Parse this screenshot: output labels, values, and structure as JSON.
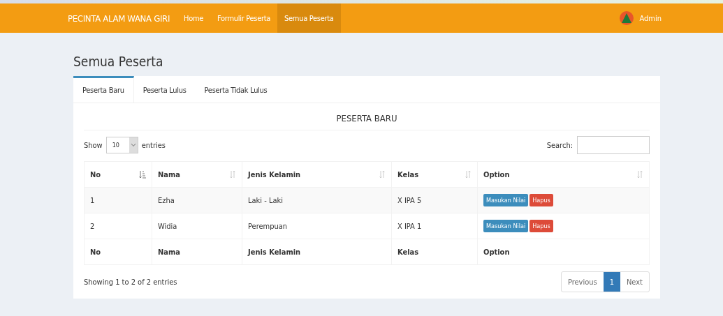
{
  "navbar": {
    "brand": "PECINTA ALAM WANA GIRI",
    "links": [
      {
        "label": "Home",
        "selected": false
      },
      {
        "label": "Formulir Peserta",
        "selected": false
      },
      {
        "label": "Semua Peserta",
        "selected": true
      }
    ],
    "user": "Admin"
  },
  "page_title": "Semua Peserta",
  "tabs": [
    {
      "label": "Peserta Baru",
      "selected": true
    },
    {
      "label": "Peserta Lulus",
      "selected": false
    },
    {
      "label": "Peserta Tidak Lulus",
      "selected": false
    }
  ],
  "section_title": "PESERTA BARU",
  "length": {
    "show": "Show",
    "value": "10",
    "entries": "entries"
  },
  "search": {
    "label": "Search:"
  },
  "table": {
    "columns": [
      {
        "label": "No",
        "sorted": true
      },
      {
        "label": "Nama",
        "sorted": false
      },
      {
        "label": "Jenis Kelamin",
        "sorted": false
      },
      {
        "label": "Kelas",
        "sorted": false
      },
      {
        "label": "Option",
        "sorted": false
      }
    ],
    "rows": [
      {
        "cells": [
          "1",
          "Ezha",
          "Laki - Laki",
          "X IPA 5"
        ],
        "actions": [
          {
            "label": "Masukan Nilai",
            "kind": "primary"
          },
          {
            "label": "Hapus",
            "kind": "danger"
          }
        ]
      },
      {
        "cells": [
          "2",
          "Widia",
          "Perempuan",
          "X IPA 1"
        ],
        "actions": [
          {
            "label": "Masukan Nilai",
            "kind": "primary"
          },
          {
            "label": "Hapus",
            "kind": "danger"
          }
        ]
      }
    ],
    "footer": [
      "No",
      "Nama",
      "Jenis Kelamin",
      "Kelas",
      "Option"
    ]
  },
  "info": "Showing 1 to 2 of 2 entries",
  "pagination": [
    {
      "label": "Previous",
      "selected": false
    },
    {
      "label": "1",
      "selected": true
    },
    {
      "label": "Next",
      "selected": false
    }
  ]
}
